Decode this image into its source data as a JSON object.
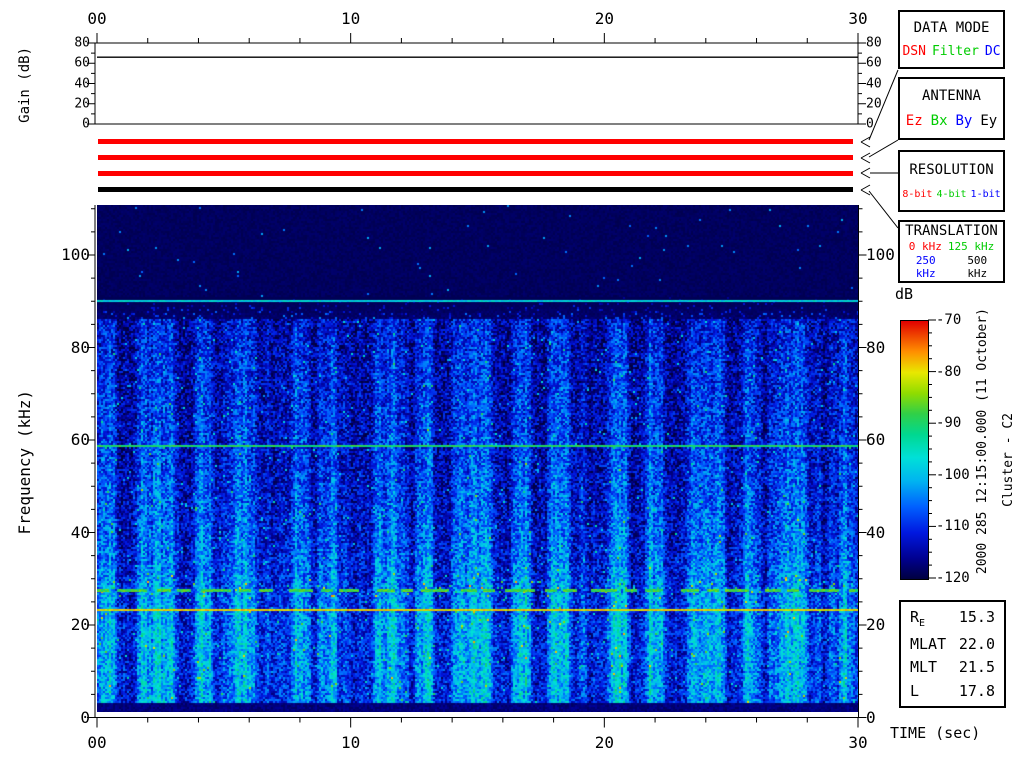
{
  "annotations": {
    "datetime_vertical": "2000 285 12:15:00.000 (11 October)",
    "spacecraft_vertical": "Cluster - C2"
  },
  "gain_panel": {
    "ylabel": "Gain (dB)",
    "ytick_labels": [
      "80",
      "60",
      "40",
      "20",
      "0"
    ],
    "ytick_values": [
      80,
      60,
      40,
      20,
      0
    ],
    "minor_step_db": 10,
    "gain_trace_db": 66
  },
  "time_axis": {
    "tick_labels": [
      "00",
      "10",
      "20",
      "30"
    ],
    "tick_values": [
      0,
      10,
      20,
      30
    ],
    "minor_step_sec": 2,
    "units_label": "TIME (sec)"
  },
  "freq_axis": {
    "label": "Frequency (kHz)",
    "tick_labels": [
      "100",
      "80",
      "60",
      "40",
      "20",
      "0"
    ],
    "tick_values": [
      100,
      80,
      60,
      40,
      20,
      0
    ],
    "minor_step_khz": 5
  },
  "status_boxes": [
    {
      "title": "DATA MODE",
      "options": [
        {
          "label": "DSN",
          "color": "#ff0000"
        },
        {
          "label": "Filter",
          "color": "#00cc00"
        },
        {
          "label": "DC",
          "color": "#0000ff"
        }
      ]
    },
    {
      "title": "ANTENNA",
      "options": [
        {
          "label": "Ez",
          "color": "#ff0000"
        },
        {
          "label": "Bx",
          "color": "#00cc00"
        },
        {
          "label": "By",
          "color": "#0000ff"
        },
        {
          "label": "Ey",
          "color": "#000000"
        }
      ]
    },
    {
      "title": "RESOLUTION",
      "options": [
        {
          "label": "8-bit",
          "color": "#ff0000"
        },
        {
          "label": "4-bit",
          "color": "#00cc00"
        },
        {
          "label": "1-bit",
          "color": "#0000ff"
        }
      ]
    },
    {
      "title": "TRANSLATION",
      "options": [
        {
          "label": "0 kHz",
          "color": "#ff0000"
        },
        {
          "label": "125 kHz",
          "color": "#00cc00"
        },
        {
          "label": "250 kHz",
          "color": "#0000ff"
        },
        {
          "label": "500 kHz",
          "color": "#000000"
        }
      ]
    }
  ],
  "status_bars": [
    {
      "name": "data-mode",
      "selected": "DSN",
      "color": "#ff0000"
    },
    {
      "name": "antenna",
      "selected": "Ez",
      "color": "#ff0000"
    },
    {
      "name": "resolution",
      "selected": "8-bit",
      "color": "#ff0000"
    },
    {
      "name": "translation",
      "selected": "500 kHz",
      "color": "#000000"
    }
  ],
  "colorbar": {
    "label": "dB",
    "tick_labels": [
      "-70",
      "-80",
      "-90",
      "-100",
      "-110",
      "-120"
    ],
    "tick_values": [
      -70,
      -80,
      -90,
      -100,
      -110,
      -120
    ],
    "minor_step_db": 2.5,
    "range_db": [
      -120,
      -70
    ],
    "colormap_stops": [
      [
        0,
        "#000040"
      ],
      [
        0.08,
        "#000090"
      ],
      [
        0.18,
        "#0018e0"
      ],
      [
        0.28,
        "#0060ff"
      ],
      [
        0.38,
        "#00b4f0"
      ],
      [
        0.47,
        "#00e0d8"
      ],
      [
        0.56,
        "#00d890"
      ],
      [
        0.64,
        "#30d048"
      ],
      [
        0.72,
        "#90dc00"
      ],
      [
        0.8,
        "#e8e800"
      ],
      [
        0.88,
        "#ff9000"
      ],
      [
        1,
        "#e00000"
      ]
    ]
  },
  "ephemeris_panel": {
    "rows": [
      {
        "label": "R",
        "sub": "E",
        "value": "15.3"
      },
      {
        "label": "MLAT",
        "sub": "",
        "value": "22.0"
      },
      {
        "label": "MLT",
        "sub": "",
        "value": "21.5"
      },
      {
        "label": "L",
        "sub": "",
        "value": "17.8"
      }
    ]
  },
  "chart_data": [
    {
      "type": "line",
      "title": "receiver gain vs time",
      "ylabel": "Gain (dB)",
      "xlabel": "",
      "xlim": [
        0,
        30
      ],
      "ylim": [
        0,
        80
      ],
      "xticks": [
        0,
        10,
        20,
        30
      ],
      "xtick_labels": [
        "00",
        "10",
        "20",
        "30"
      ],
      "yticks": [
        0,
        20,
        40,
        60,
        80
      ],
      "x": [
        0,
        30
      ],
      "series": [
        {
          "name": "gain",
          "values": [
            66,
            66
          ]
        }
      ],
      "grid": false
    },
    {
      "type": "heatmap",
      "subtype": "spectrogram",
      "title": "Cluster C2 WBD wideband spectrogram, 2000 285 12:15:00.000",
      "xlabel": "TIME (sec)",
      "ylabel": "Frequency (kHz)",
      "xlim": [
        0,
        30
      ],
      "ylim": [
        0,
        110.8
      ],
      "colorbar_label": "dB",
      "colorbar_range": [
        -120,
        -70
      ],
      "colorbar_ticks": [
        -70,
        -80,
        -90,
        -100,
        -110,
        -120
      ],
      "features": {
        "background_above_91khz_db": -119,
        "noise_band": {
          "freq_range_khz": [
            3,
            86
          ],
          "level_db_range": [
            -113,
            -97
          ],
          "striation_period_sec": 1.8,
          "description": "broadband hiss with quasi-periodic vertical striations"
        },
        "spectral_lines": [
          {
            "freq_khz": 90.2,
            "style": "solid",
            "level_db": -99,
            "appearance": "cyan"
          },
          {
            "freq_khz": 59.0,
            "style": "solid",
            "level_db": -91,
            "appearance": "green"
          },
          {
            "freq_khz": 27.8,
            "style": "dashed",
            "level_db": -89,
            "appearance": "green"
          },
          {
            "freq_khz": 23.5,
            "style": "solid",
            "level_db": -81,
            "appearance": "yellow"
          }
        ]
      }
    }
  ]
}
